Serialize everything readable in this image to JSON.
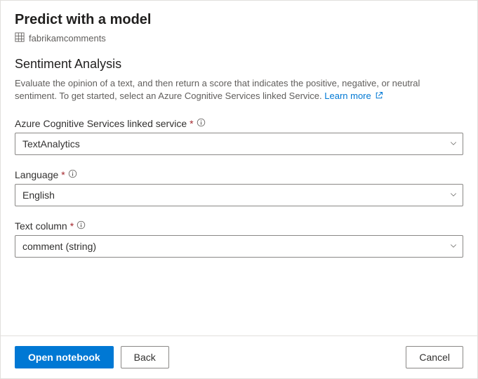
{
  "header": {
    "title": "Predict with a model",
    "breadcrumb": "fabrikamcomments"
  },
  "section": {
    "title": "Sentiment Analysis",
    "description": "Evaluate the opinion of a text, and then return a score that indicates the positive, negative, or neutral sentiment. To get started, select an Azure Cognitive Services linked Service. ",
    "learn_more": "Learn more"
  },
  "fields": {
    "linked_service": {
      "label": "Azure Cognitive Services linked service",
      "value": "TextAnalytics"
    },
    "language": {
      "label": "Language",
      "value": "English"
    },
    "text_column": {
      "label": "Text column",
      "value": "comment (string)"
    }
  },
  "footer": {
    "primary": "Open notebook",
    "back": "Back",
    "cancel": "Cancel"
  }
}
